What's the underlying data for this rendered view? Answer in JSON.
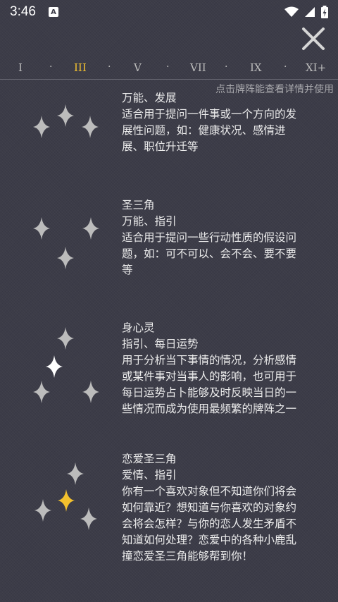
{
  "status": {
    "time": "3:46",
    "notification_icon": "A"
  },
  "nav": {
    "numerals": [
      "I",
      "III",
      "V",
      "VII",
      "IX",
      "XI+"
    ],
    "active_index": 1,
    "separator": "·"
  },
  "hint": "点击牌阵能查看详情并使用",
  "colors": {
    "star_default": "#bcbcbc",
    "star_highlight_white": "#ffffff",
    "star_highlight_gold": "#f3c12e",
    "active_numeral": "#f2c130"
  },
  "spreads": [
    {
      "lines": [
        "万能、发展",
        "适合用于提问一件事或一个方向的发",
        "展性问题，如：健康状况、感情进",
        "展、职位升迁等"
      ]
    },
    {
      "lines": [
        "圣三角",
        "万能、指引",
        "适合用于提问一些行动性质的假设问",
        "题，如：可不可以、会不会、要不要",
        "等"
      ]
    },
    {
      "lines": [
        "身心灵",
        "指引、每日运势",
        "用于分析当下事情的情况，分析感情",
        "或某件事对当事人的影响，也可用于",
        "每日运势占卜能够及时反映当日的一",
        "些情况而成为使用最频繁的牌阵之一"
      ]
    },
    {
      "lines": [
        "恋爱圣三角",
        "爱情、指引",
        "你有一个喜欢对象但不知道你们将会",
        "如何靠近？想知道与你喜欢的对象约",
        "会将会怎样？与你的恋人发生矛盾不",
        "知道如何处理？恋爱中的各种小鹿乱",
        "撞恋爱圣三角能够帮到你！"
      ]
    }
  ]
}
